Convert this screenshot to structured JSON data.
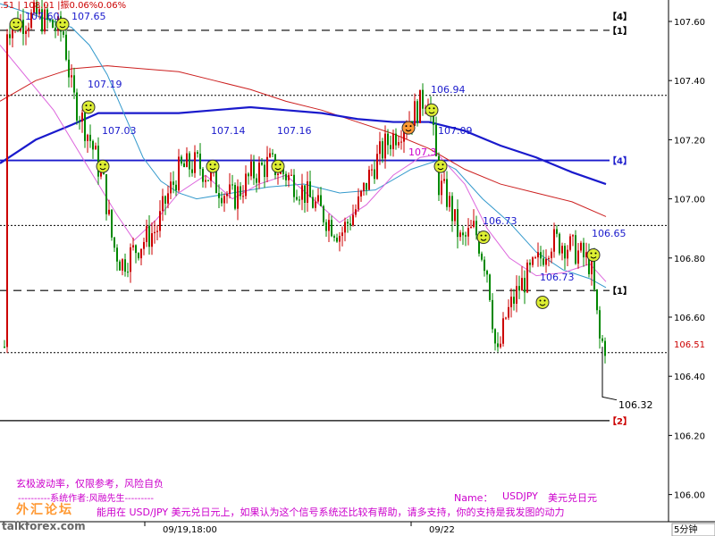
{
  "colors": {
    "bull": "#cc0000",
    "bear": "#008800",
    "ma_blue": "#1a1acc",
    "ma_red": "#cc1f1f",
    "ma_cyan": "#3399cc",
    "ma_pink": "#dd66dd",
    "level": "#000000",
    "current": "#cc0000"
  },
  "chart_data": {
    "type": "candlestick",
    "timeframe": "5分钟",
    "x_labels": [
      "09/19,18:00",
      "09/22"
    ],
    "ylim": [
      106.0,
      107.66
    ],
    "y_ticks": [
      "107.60",
      "107.40",
      "107.20",
      "107.00",
      "106.80",
      "106.60",
      "106.40",
      "106.20",
      "106.00"
    ],
    "current_price": "106.51",
    "levels": [
      {
        "label": "【1】",
        "price": 107.57,
        "style": "dashed"
      },
      {
        "label": "",
        "price": 107.35,
        "style": "dotted"
      },
      {
        "label": "【4】",
        "price": 107.13,
        "style": "solid"
      },
      {
        "label": "",
        "price": 106.91,
        "style": "dotted"
      },
      {
        "label": "【1】",
        "price": 106.69,
        "style": "dashed"
      },
      {
        "label": "",
        "price": 106.48,
        "style": "dotted"
      },
      {
        "label": "【2】",
        "price": 106.25,
        "style": "solid"
      }
    ],
    "top_label": "【4】",
    "price_labels": [
      {
        "text": "107.60",
        "color": "blue"
      },
      {
        "text": "107.65",
        "color": "blue"
      },
      {
        "text": "107.19",
        "color": "blue"
      },
      {
        "text": "107.03",
        "color": "blue"
      },
      {
        "text": "107.14",
        "color": "blue"
      },
      {
        "text": "107.16",
        "color": "blue"
      },
      {
        "text": "106.94",
        "color": "blue"
      },
      {
        "text": "107.09",
        "color": "blue"
      },
      {
        "text": "107.3",
        "color": "pink"
      },
      {
        "text": "106.73",
        "color": "blue"
      },
      {
        "text": "106.65",
        "color": "blue"
      },
      {
        "text": "106.73",
        "color": "blue"
      },
      {
        "text": "106.32",
        "color": "black"
      }
    ],
    "header_fragment": "5.51 | 108.01 |振0.06%0.06%"
  },
  "text": {
    "line1": "玄极波动率，仅限参考，风险自负",
    "line2": "----------系统作者:风融先生---------",
    "line3": "能用在 USD/JPY 美元兑日元上，如果认为这个信号系统还比较有帮助，请多支持，你的支持是我发图的动力",
    "name_label": "Name：",
    "symbol": "USDJPY",
    "symbol_name": "美元兑日元",
    "watermark_cn": "外汇论坛",
    "watermark_url": "talkforex.com"
  }
}
